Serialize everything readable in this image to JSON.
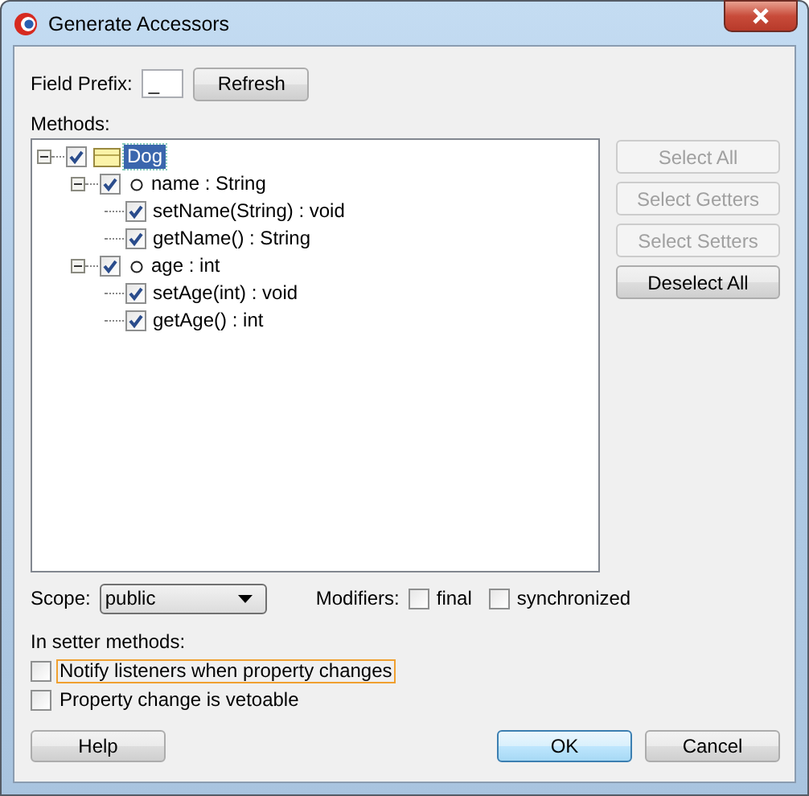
{
  "window": {
    "title": "Generate Accessors"
  },
  "field_prefix": {
    "label": "Field Prefix:",
    "value": "_"
  },
  "refresh_button": {
    "label": "Refresh"
  },
  "methods_label": "Methods:",
  "tree": [
    {
      "kind": "class",
      "label": "Dog",
      "checked": true,
      "selected": true,
      "expanded": true,
      "children": [
        {
          "kind": "field",
          "label": "name : String",
          "checked": true,
          "selected": false,
          "expanded": true,
          "children": [
            {
              "label": "setName(String) : void",
              "checked": true,
              "selected": false
            },
            {
              "label": "getName() : String",
              "checked": true,
              "selected": false
            }
          ]
        },
        {
          "kind": "field",
          "label": "age : int",
          "checked": true,
          "selected": false,
          "expanded": true,
          "children": [
            {
              "label": "setAge(int) : void",
              "checked": true,
              "selected": false
            },
            {
              "label": "getAge() : int",
              "checked": true,
              "selected": false
            }
          ]
        }
      ]
    }
  ],
  "side_buttons": [
    {
      "label": "Select All",
      "disabled": true
    },
    {
      "label": "Select Getters",
      "disabled": true
    },
    {
      "label": "Select Setters",
      "disabled": true
    },
    {
      "label": "Deselect All",
      "disabled": false
    }
  ],
  "scope": {
    "label": "Scope:",
    "value": "public"
  },
  "modifiers": {
    "label": "Modifiers:",
    "options": [
      {
        "label": "final",
        "checked": false
      },
      {
        "label": "synchronized",
        "checked": false
      }
    ]
  },
  "setter_label": "In setter methods:",
  "setter_options": [
    {
      "label": "Notify listeners when property changes",
      "checked": false,
      "focused": true
    },
    {
      "label": "Property change is vetoable",
      "checked": false,
      "focused": false
    }
  ],
  "buttons": [
    {
      "label": "Help",
      "default": false
    },
    {
      "label": "OK",
      "default": true
    },
    {
      "label": "Cancel",
      "default": false
    }
  ]
}
